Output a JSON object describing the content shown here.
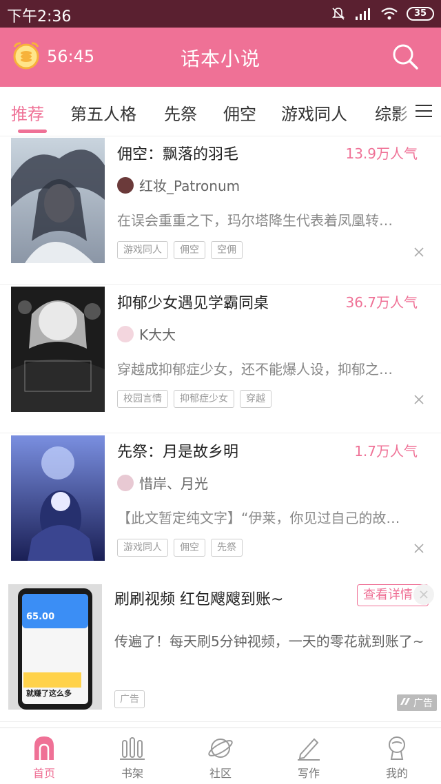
{
  "status_bar": {
    "time": "下午2:36",
    "battery": "35"
  },
  "header": {
    "timer": "56:45",
    "title": "话本小说"
  },
  "tabs": [
    {
      "label": "推荐",
      "active": true
    },
    {
      "label": "第五人格"
    },
    {
      "label": "先祭"
    },
    {
      "label": "佣空"
    },
    {
      "label": "游戏同人"
    },
    {
      "label": "综影"
    }
  ],
  "books": [
    {
      "title": "佣空：飘落的羽毛",
      "popularity": "13.9万人气",
      "author": "红妆_Patronum",
      "description": "在误会重重之下，玛尔塔降生代表着凤凰转…",
      "tags": [
        "游戏同人",
        "佣空",
        "空佣"
      ]
    },
    {
      "title": "抑郁少女遇见学霸同桌",
      "popularity": "36.7万人气",
      "author": "K大大",
      "description": "穿越成抑郁症少女，还不能爆人设，抑郁之…",
      "tags": [
        "校园言情",
        "抑郁症少女",
        "穿越"
      ]
    },
    {
      "title": "先祭：月是故乡明",
      "popularity": "1.7万人气",
      "author": "惜岸、月光",
      "description": "【此文暂定纯文字】“伊莱，你见过自己的故…",
      "tags": [
        "游戏同人",
        "佣空",
        "先祭"
      ]
    }
  ],
  "ad": {
    "title": "刷刷视频 红包飕飕到账~",
    "button": "查看详情",
    "description": "传遍了！每天刷5分钟视频，一天的零花就到账了~",
    "tag": "广告",
    "mark": "广告",
    "image_amount": "65.00",
    "image_caption": "就赚了这么多"
  },
  "bottom_nav": [
    {
      "label": "首页",
      "icon": "home-icon",
      "active": true
    },
    {
      "label": "书架",
      "icon": "bookshelf-icon"
    },
    {
      "label": "社区",
      "icon": "planet-icon"
    },
    {
      "label": "写作",
      "icon": "pen-icon"
    },
    {
      "label": "我的",
      "icon": "profile-icon"
    }
  ],
  "colors": {
    "accent": "#ef7196",
    "status_bar": "#5a2030"
  }
}
